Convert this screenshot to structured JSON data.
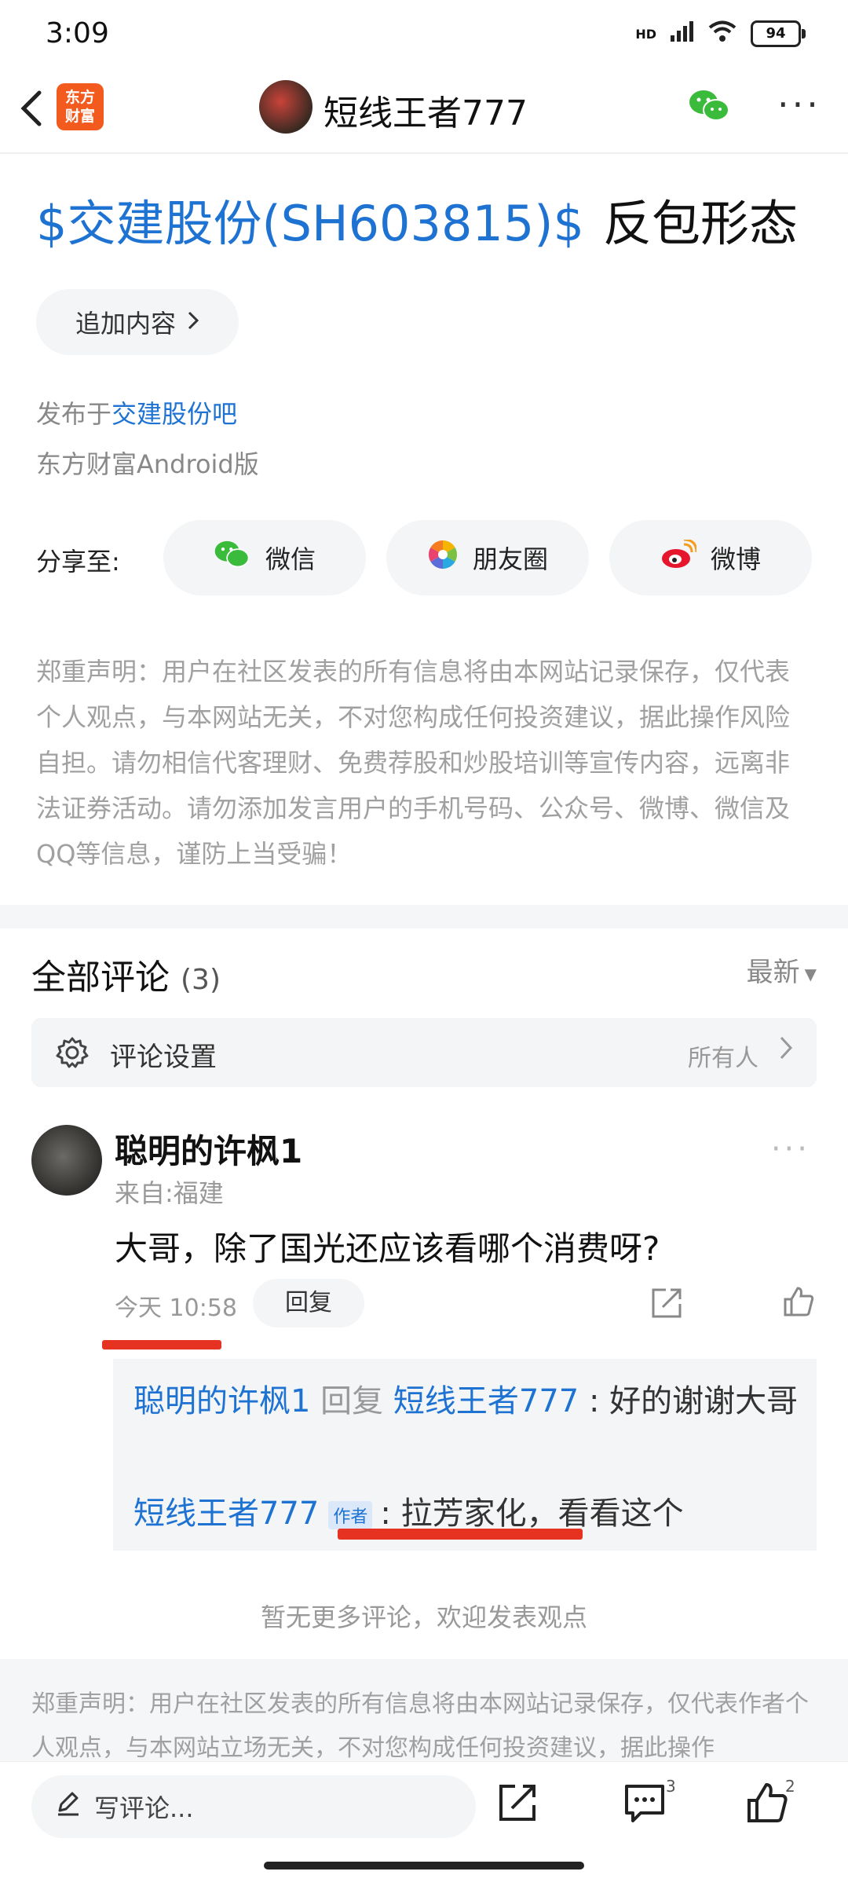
{
  "status": {
    "time": "3:09",
    "network": "HD",
    "battery": "94"
  },
  "nav": {
    "logo_line1": "东方",
    "logo_line2": "财富",
    "title": "短线王者777"
  },
  "post": {
    "title_stock": "$交建股份(SH603815)$",
    "title_rest": "反包形态",
    "add_content": "追加内容",
    "published_prefix": "发布于",
    "forum": "交建股份吧",
    "source": "东方财富Android版"
  },
  "share": {
    "label": "分享至:",
    "wechat": "微信",
    "moments": "朋友圈",
    "weibo": "微博"
  },
  "disclaimer": "郑重声明：用户在社区发表的所有信息将由本网站记录保存，仅代表个人观点，与本网站无关，不对您构成任何投资建议，据此操作风险自担。请勿相信代客理财、免费荐股和炒股培训等宣传内容，远离非法证券活动。请勿添加发言用户的手机号码、公众号、微博、微信及QQ等信息，谨防上当受骗！",
  "comments": {
    "title": "全部评论",
    "count": "(3)",
    "sort": "最新",
    "settings_label": "评论设置",
    "settings_value": "所有人",
    "items": [
      {
        "user": "聪明的许枫1",
        "location": "来自:福建",
        "text": "大哥，除了国光还应该看哪个消费呀?",
        "time": "今天 10:58",
        "reply_label": "回复"
      }
    ],
    "replies": [
      {
        "user": "聪明的许枫1",
        "reply_word": "回复",
        "target": "短线王者777",
        "text": "好的谢谢大哥"
      },
      {
        "user": "短线王者777",
        "tag": "作者",
        "text": "拉芳家化，看看这个"
      }
    ],
    "no_more": "暂无更多评论，欢迎发表观点"
  },
  "bottom_disclaimer": "郑重声明：用户在社区发表的所有信息将由本网站记录保存，仅代表作者个人观点，与本网站立场无关，不对您构成任何投资建议，据此操作",
  "bottom_bar": {
    "write_placeholder": "写评论...",
    "comment_count": "3",
    "like_count": "2"
  },
  "colors": {
    "accent": "#1e73d2",
    "brand": "#f25a1e",
    "marker": "#e63220"
  }
}
